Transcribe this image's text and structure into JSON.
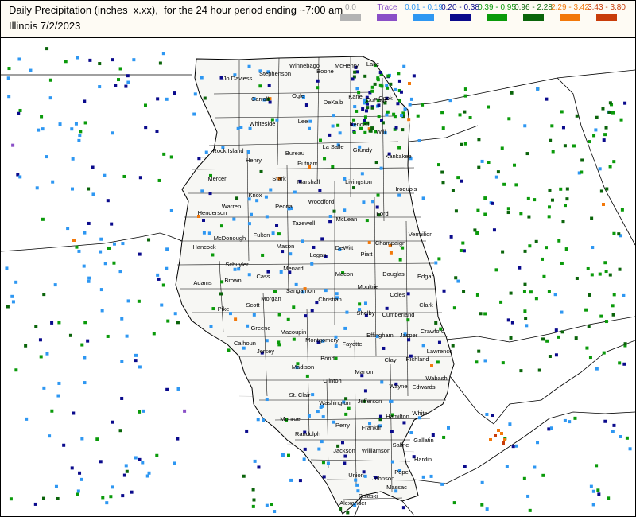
{
  "header": {
    "title": "Daily Precipitation (inches  x.xx),  for the 24 hour period ending ~7:00 am",
    "subtitle": "Illinois 7/2/2023"
  },
  "legend": [
    {
      "label": "0.0",
      "color": "#b3b3b3",
      "text_color": "#a0a0a0"
    },
    {
      "label": "Trace",
      "color": "#8a4fc7",
      "text_color": "#8a4fc7"
    },
    {
      "label": "0.01 - 0.19",
      "color": "#2e97f2",
      "text_color": "#2e97f2"
    },
    {
      "label": "0.20 - 0.38",
      "color": "#0a0a8c",
      "text_color": "#0a0a8c"
    },
    {
      "label": "0.39 - 0.95",
      "color": "#0a9a0a",
      "text_color": "#0a9a0a"
    },
    {
      "label": "0.96 - 2.28",
      "color": "#0a640a",
      "text_color": "#0a640a"
    },
    {
      "label": "2.29 - 3.42",
      "color": "#f2780a",
      "text_color": "#f2780a"
    },
    {
      "label": "3.43 - 3.80",
      "color": "#c83c0a",
      "text_color": "#c83c0a"
    }
  ],
  "counties": [
    "Jo Daviess",
    "Stephenson",
    "Winnebago",
    "Boone",
    "McHenry",
    "Lake",
    "Carroll",
    "Ogle",
    "DeKalb",
    "Kane",
    "Cook",
    "DuPage",
    "Whiteside",
    "Lee",
    "Kendall",
    "Will",
    "Rock Island",
    "Henry",
    "Bureau",
    "La Salle",
    "Grundy",
    "Kankakee",
    "Mercer",
    "Stark",
    "Putnam",
    "Marshall",
    "Livingston",
    "Iroquois",
    "Knox",
    "Peoria",
    "Woodford",
    "Warren",
    "Henderson",
    "Tazewell",
    "McLean",
    "Ford",
    "McDonough",
    "Fulton",
    "Vermilion",
    "Hancock",
    "Mason",
    "DeWitt",
    "Piatt",
    "Champaign",
    "Schuyler",
    "Logan",
    "Cass",
    "Menard",
    "Adams",
    "Brown",
    "Macon",
    "Douglas",
    "Edgar",
    "Moultrie",
    "Morgan",
    "Sangamon",
    "Christian",
    "Coles",
    "Pike",
    "Scott",
    "Clark",
    "Shelby",
    "Cumberland",
    "Greene",
    "Macoupin",
    "Montgomery",
    "Fayette",
    "Effingham",
    "Jasper",
    "Crawford",
    "Calhoun",
    "Jersey",
    "Lawrence",
    "Bond",
    "Clay",
    "Richland",
    "Madison",
    "Marion",
    "Wabash",
    "Clinton",
    "Wayne",
    "Edwards",
    "St. Clair",
    "Washington",
    "Jefferson",
    "White",
    "Hamilton",
    "Monroe",
    "Perry",
    "Franklin",
    "Randolph",
    "Gallatin",
    "Saline",
    "Jackson",
    "Williamson",
    "Hardin",
    "Pope",
    "Union",
    "Johnson",
    "Massac",
    "Pulaski",
    "Alexander"
  ]
}
